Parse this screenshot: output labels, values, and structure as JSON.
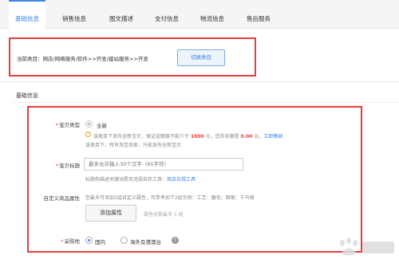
{
  "tabs": [
    {
      "label": "基础信息",
      "active": true
    },
    {
      "label": "销售信息",
      "active": false
    },
    {
      "label": "图文描述",
      "active": false
    },
    {
      "label": "支付信息",
      "active": false
    },
    {
      "label": "物流信息",
      "active": false
    },
    {
      "label": "售后服务",
      "active": false
    }
  ],
  "category": {
    "current_text": "当前类目：网店/网络服务/软件>>开发/建站服务>>开发",
    "switch_label": "切换类目"
  },
  "section_title": "基础信息",
  "form": {
    "item_type": {
      "label": "宝贝类型",
      "option": "全新",
      "hint_line1_pre": "该类目下发布全新宝贝，保证金额度不能少于",
      "hint_amount1": "1000",
      "hint_line1_mid": "元，您的余额是",
      "hint_amount2": "0.00",
      "hint_line1_post": "元，",
      "hint_link": "立即缴纳",
      "hint_line2": "该类目下，所有淘宝卖家，只能发布全新宝贝"
    },
    "item_title": {
      "label": "宝贝标题",
      "placeholder": "最多允许输入30个汉字（60字符）",
      "hint_pre": "标题和描述关键词是否违规自检工具：",
      "hint_link": "商品合规工具"
    },
    "custom_attr": {
      "label": "自定义商品属性",
      "hint": "您最多可添加5组自定义属性，可参考如下2组示例：工艺：磨毛；图案：千鸟格",
      "button": "添加属性",
      "count_hint": "属性总数最多 5 组"
    },
    "purchase_place": {
      "label": "采购地",
      "option_domestic": "国内",
      "option_overseas": "海外及港澳台"
    }
  },
  "colors": {
    "accent": "#3d86e6",
    "highlight": "#e63c3c",
    "warning": "#e0a43a"
  }
}
